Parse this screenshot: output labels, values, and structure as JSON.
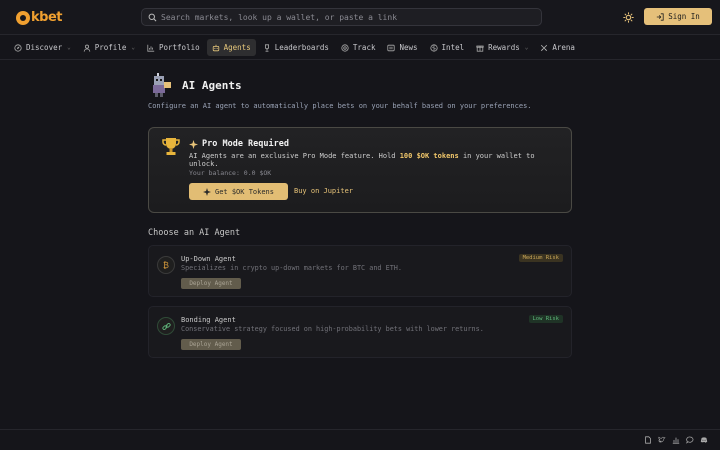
{
  "header": {
    "logo_text": "kbet",
    "search_placeholder": "Search markets, look up a wallet, or paste a link",
    "theme_icon": "sun-icon",
    "signin_label": "Sign In"
  },
  "nav": {
    "items": [
      {
        "label": "Discover",
        "icon": "compass-icon"
      },
      {
        "label": "Profile",
        "icon": "user-icon"
      },
      {
        "label": "Portfolio",
        "icon": "chart-icon"
      },
      {
        "label": "Agents",
        "icon": "bot-icon"
      },
      {
        "label": "Leaderboards",
        "icon": "trophy-icon"
      },
      {
        "label": "Track",
        "icon": "target-icon"
      },
      {
        "label": "News",
        "icon": "newspaper-icon"
      },
      {
        "label": "Intel",
        "icon": "brain-icon"
      },
      {
        "label": "Rewards",
        "icon": "gift-icon"
      },
      {
        "label": "Arena",
        "icon": "swords-icon"
      }
    ],
    "active": "Agents"
  },
  "main": {
    "title": "AI Agents",
    "description": "Configure an AI agent to automatically place bets on your behalf based on your preferences.",
    "pro": {
      "title": "Pro Mode Required",
      "text_before": "AI Agents are an exclusive Pro Mode feature. Hold ",
      "highlight": "100 $OK tokens",
      "text_after": " in your wallet to unlock.",
      "balance": "Your balance: 0.0 $OK",
      "get_label": "Get $OK Tokens",
      "jupiter_label": "Buy on Jupiter"
    },
    "section_title": "Choose an AI Agent",
    "agents": [
      {
        "name": "Up-Down Agent",
        "description": "Specializes in crypto up-down markets for BTC and ETH.",
        "risk": "Medium Risk",
        "deploy_label": "Deploy Agent",
        "icon": "bitcoin-icon"
      },
      {
        "name": "Bonding Agent",
        "description": "Conservative strategy focused on high-probability bets with lower returns.",
        "risk": "Low Risk",
        "deploy_label": "Deploy Agent",
        "icon": "link-icon"
      }
    ]
  },
  "colors": {
    "accent": "#e5c07a",
    "background": "#15151a",
    "highlight": "#f2c86b",
    "medium_risk": "#c9a658",
    "low_risk": "#5fb57a"
  },
  "footer": {
    "icons": [
      "document-icon",
      "twitter-icon",
      "stats-icon",
      "chat-icon",
      "discord-icon"
    ]
  }
}
